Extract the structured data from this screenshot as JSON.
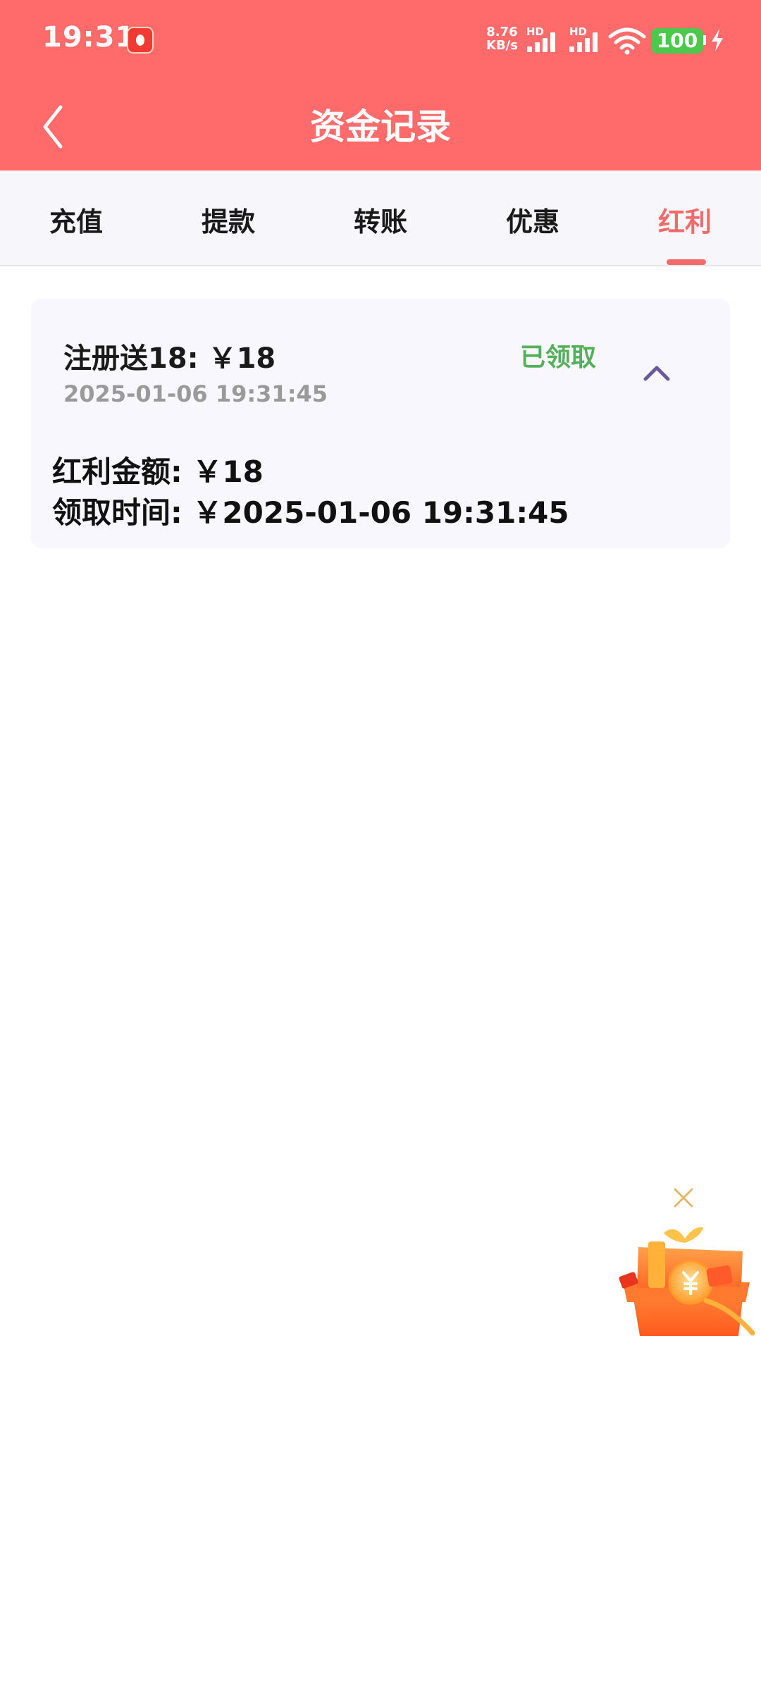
{
  "status_bar": {
    "time": "19:31",
    "net_speed_value": "8.76",
    "net_speed_unit": "KB/s",
    "hd_label_1": "HD",
    "hd_label_2": "HD",
    "battery_level": "100",
    "icons": [
      "app-notification-icon",
      "signal-icon",
      "signal-icon",
      "wifi-icon",
      "battery-icon",
      "charging-icon"
    ]
  },
  "header": {
    "title": "资金记录",
    "back_icon": "chevron-left-icon"
  },
  "tabs": [
    {
      "label": "充值",
      "active": false
    },
    {
      "label": "提款",
      "active": false
    },
    {
      "label": "转账",
      "active": false
    },
    {
      "label": "优惠",
      "active": false
    },
    {
      "label": "红利",
      "active": true
    }
  ],
  "record": {
    "title": "注册送18: ￥18",
    "date": "2025-01-06 19:31:45",
    "status": "已领取",
    "expand_icon": "chevron-up-icon",
    "details": [
      "红利金额: ￥18",
      "领取时间: ￥2025-01-06 19:31:45"
    ]
  },
  "floating_gift": {
    "icons": [
      "close-icon",
      "gift-box-icon"
    ]
  },
  "colors": {
    "header_bg": "#ff6a6a",
    "accent": "#f26a6a",
    "status_green": "#55b059",
    "card_bg": "#f7f7fd",
    "chevron": "#6b5a9a"
  }
}
